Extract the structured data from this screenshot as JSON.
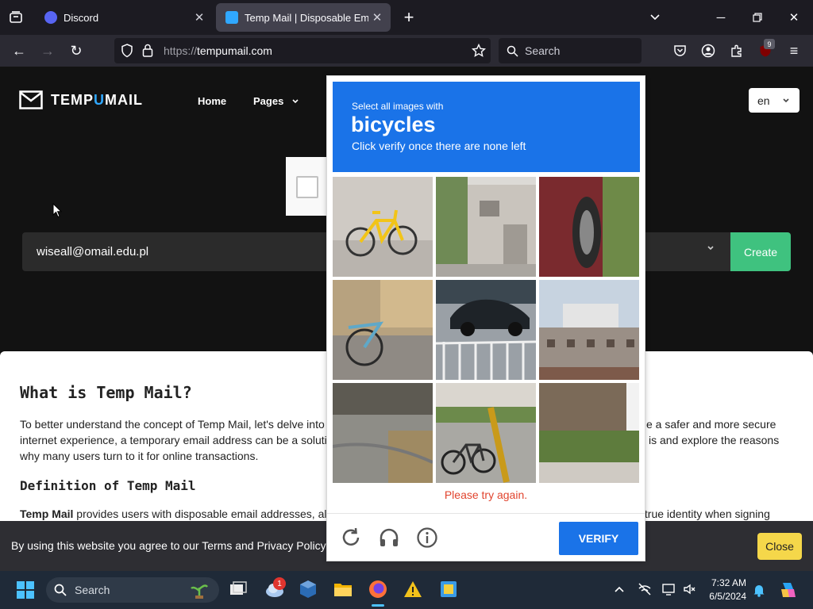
{
  "browser": {
    "tabs": [
      {
        "title": "Discord"
      },
      {
        "title": "Temp Mail | Disposable Email Address"
      }
    ],
    "url_protocol": "https://",
    "url_host": "tempumail.com",
    "search_placeholder": "Search",
    "extension_badge": "9"
  },
  "site": {
    "logo_prefix": "TEMP",
    "logo_u": "U",
    "logo_suffix": "MAIL",
    "nav": {
      "home": "Home",
      "pages": "Pages"
    },
    "language": "en",
    "email": "wiseall@omail.edu.pl",
    "create_label": "Create"
  },
  "article": {
    "heading": "What is Temp Mail?",
    "para1_line1_a": "To better understand the concept of Temp Mail, let's delve into",
    "para1_line1_b": "e a safer and more secure",
    "para1_line2_a": "internet experience, a temporary email address can be a solutio",
    "para1_line2_b": "is and explore the reasons",
    "para1_line3": "why many users turn to it for online transactions.",
    "subheading": "Definition of Temp Mail",
    "para2_bold": "Temp Mail",
    "para2_a": " provides users with disposable email addresses, al",
    "para2_b": "s true identity when signing"
  },
  "cookie": {
    "text": "By using this website you agree to our Terms and Privacy Policy",
    "close_label": "Close"
  },
  "captcha": {
    "instruction": "Select all images with",
    "target": "bicycles",
    "subtext": "Click verify once there are none left",
    "error": "Please try again.",
    "verify_label": "VERIFY",
    "tiles": [
      "bicycle",
      "building",
      "car",
      "bicycle",
      "car",
      "fence",
      "street",
      "bicycle",
      "garden"
    ]
  },
  "taskbar": {
    "search_label": "Search",
    "weather_badge": "1",
    "time": "7:32 AM",
    "date": "6/5/2024"
  }
}
